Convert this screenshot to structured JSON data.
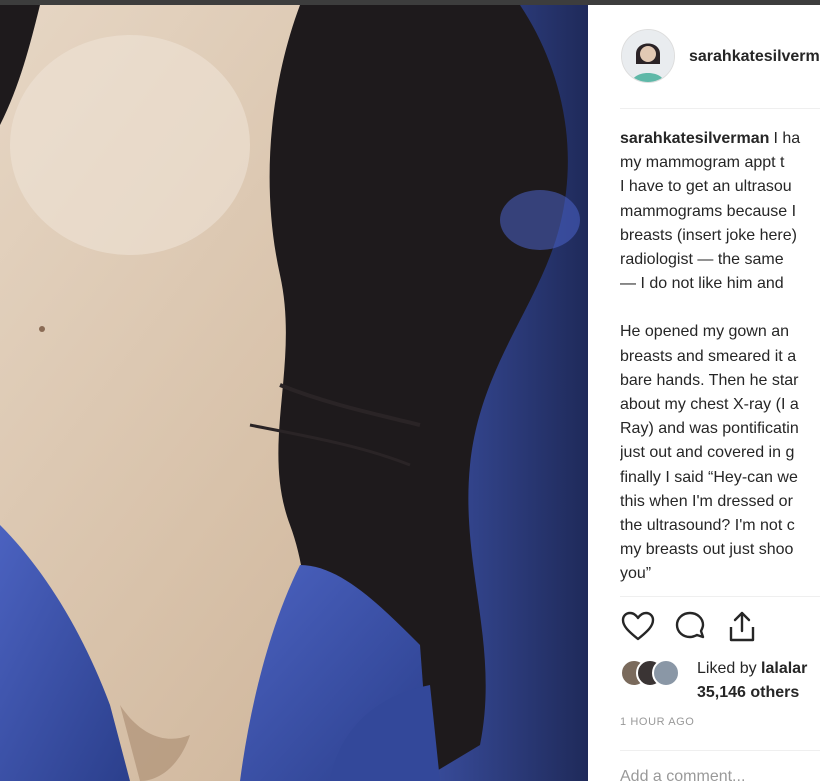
{
  "post": {
    "username": "sarahkatesilverman",
    "caption_author": "sarahkatesilverman",
    "caption_lines": [
      "I ha",
      "my mammogram appt t",
      "I have to get an ultrasou",
      "mammograms because I",
      "breasts (insert joke here)",
      "radiologist — the same",
      "— I do not like him and"
    ],
    "caption_paragraph2_lines": [
      "He opened my gown an",
      "breasts and smeared it a",
      "bare hands. Then he star",
      "about my chest X-ray (I a",
      "Ray) and was pontificatin",
      "just out and covered in g",
      "finally I said “Hey-can we",
      "this when I'm dressed or",
      "the ultrasound? I'm not c",
      "my breasts out just shoo",
      "you”"
    ],
    "likes_prefix": "Liked by",
    "likes_user": "lalalar",
    "likes_others": "35,146 others",
    "timestamp": "1 HOUR AGO",
    "comment_placeholder": "Add a comment..."
  },
  "icons": [
    "heart-icon",
    "comment-icon",
    "share-icon"
  ],
  "colors": {
    "text": "#262626",
    "muted": "#999999",
    "separator": "#efefef",
    "shirt": "#3b52a6",
    "hair": "#1e1a1c"
  }
}
